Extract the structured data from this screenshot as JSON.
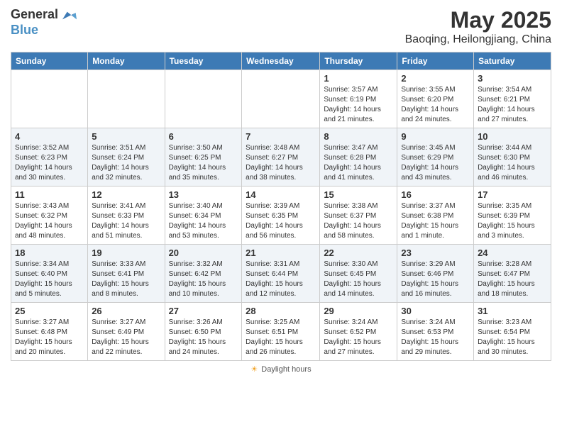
{
  "header": {
    "logo_general": "General",
    "logo_blue": "Blue",
    "month": "May 2025",
    "location": "Baoqing, Heilongjiang, China"
  },
  "days_of_week": [
    "Sunday",
    "Monday",
    "Tuesday",
    "Wednesday",
    "Thursday",
    "Friday",
    "Saturday"
  ],
  "weeks": [
    [
      {
        "day": "",
        "info": ""
      },
      {
        "day": "",
        "info": ""
      },
      {
        "day": "",
        "info": ""
      },
      {
        "day": "",
        "info": ""
      },
      {
        "day": "1",
        "info": "Sunrise: 3:57 AM\nSunset: 6:19 PM\nDaylight: 14 hours\nand 21 minutes."
      },
      {
        "day": "2",
        "info": "Sunrise: 3:55 AM\nSunset: 6:20 PM\nDaylight: 14 hours\nand 24 minutes."
      },
      {
        "day": "3",
        "info": "Sunrise: 3:54 AM\nSunset: 6:21 PM\nDaylight: 14 hours\nand 27 minutes."
      }
    ],
    [
      {
        "day": "4",
        "info": "Sunrise: 3:52 AM\nSunset: 6:23 PM\nDaylight: 14 hours\nand 30 minutes."
      },
      {
        "day": "5",
        "info": "Sunrise: 3:51 AM\nSunset: 6:24 PM\nDaylight: 14 hours\nand 32 minutes."
      },
      {
        "day": "6",
        "info": "Sunrise: 3:50 AM\nSunset: 6:25 PM\nDaylight: 14 hours\nand 35 minutes."
      },
      {
        "day": "7",
        "info": "Sunrise: 3:48 AM\nSunset: 6:27 PM\nDaylight: 14 hours\nand 38 minutes."
      },
      {
        "day": "8",
        "info": "Sunrise: 3:47 AM\nSunset: 6:28 PM\nDaylight: 14 hours\nand 41 minutes."
      },
      {
        "day": "9",
        "info": "Sunrise: 3:45 AM\nSunset: 6:29 PM\nDaylight: 14 hours\nand 43 minutes."
      },
      {
        "day": "10",
        "info": "Sunrise: 3:44 AM\nSunset: 6:30 PM\nDaylight: 14 hours\nand 46 minutes."
      }
    ],
    [
      {
        "day": "11",
        "info": "Sunrise: 3:43 AM\nSunset: 6:32 PM\nDaylight: 14 hours\nand 48 minutes."
      },
      {
        "day": "12",
        "info": "Sunrise: 3:41 AM\nSunset: 6:33 PM\nDaylight: 14 hours\nand 51 minutes."
      },
      {
        "day": "13",
        "info": "Sunrise: 3:40 AM\nSunset: 6:34 PM\nDaylight: 14 hours\nand 53 minutes."
      },
      {
        "day": "14",
        "info": "Sunrise: 3:39 AM\nSunset: 6:35 PM\nDaylight: 14 hours\nand 56 minutes."
      },
      {
        "day": "15",
        "info": "Sunrise: 3:38 AM\nSunset: 6:37 PM\nDaylight: 14 hours\nand 58 minutes."
      },
      {
        "day": "16",
        "info": "Sunrise: 3:37 AM\nSunset: 6:38 PM\nDaylight: 15 hours\nand 1 minute."
      },
      {
        "day": "17",
        "info": "Sunrise: 3:35 AM\nSunset: 6:39 PM\nDaylight: 15 hours\nand 3 minutes."
      }
    ],
    [
      {
        "day": "18",
        "info": "Sunrise: 3:34 AM\nSunset: 6:40 PM\nDaylight: 15 hours\nand 5 minutes."
      },
      {
        "day": "19",
        "info": "Sunrise: 3:33 AM\nSunset: 6:41 PM\nDaylight: 15 hours\nand 8 minutes."
      },
      {
        "day": "20",
        "info": "Sunrise: 3:32 AM\nSunset: 6:42 PM\nDaylight: 15 hours\nand 10 minutes."
      },
      {
        "day": "21",
        "info": "Sunrise: 3:31 AM\nSunset: 6:44 PM\nDaylight: 15 hours\nand 12 minutes."
      },
      {
        "day": "22",
        "info": "Sunrise: 3:30 AM\nSunset: 6:45 PM\nDaylight: 15 hours\nand 14 minutes."
      },
      {
        "day": "23",
        "info": "Sunrise: 3:29 AM\nSunset: 6:46 PM\nDaylight: 15 hours\nand 16 minutes."
      },
      {
        "day": "24",
        "info": "Sunrise: 3:28 AM\nSunset: 6:47 PM\nDaylight: 15 hours\nand 18 minutes."
      }
    ],
    [
      {
        "day": "25",
        "info": "Sunrise: 3:27 AM\nSunset: 6:48 PM\nDaylight: 15 hours\nand 20 minutes."
      },
      {
        "day": "26",
        "info": "Sunrise: 3:27 AM\nSunset: 6:49 PM\nDaylight: 15 hours\nand 22 minutes."
      },
      {
        "day": "27",
        "info": "Sunrise: 3:26 AM\nSunset: 6:50 PM\nDaylight: 15 hours\nand 24 minutes."
      },
      {
        "day": "28",
        "info": "Sunrise: 3:25 AM\nSunset: 6:51 PM\nDaylight: 15 hours\nand 26 minutes."
      },
      {
        "day": "29",
        "info": "Sunrise: 3:24 AM\nSunset: 6:52 PM\nDaylight: 15 hours\nand 27 minutes."
      },
      {
        "day": "30",
        "info": "Sunrise: 3:24 AM\nSunset: 6:53 PM\nDaylight: 15 hours\nand 29 minutes."
      },
      {
        "day": "31",
        "info": "Sunrise: 3:23 AM\nSunset: 6:54 PM\nDaylight: 15 hours\nand 30 minutes."
      }
    ]
  ],
  "footer": {
    "label": "Daylight hours"
  }
}
